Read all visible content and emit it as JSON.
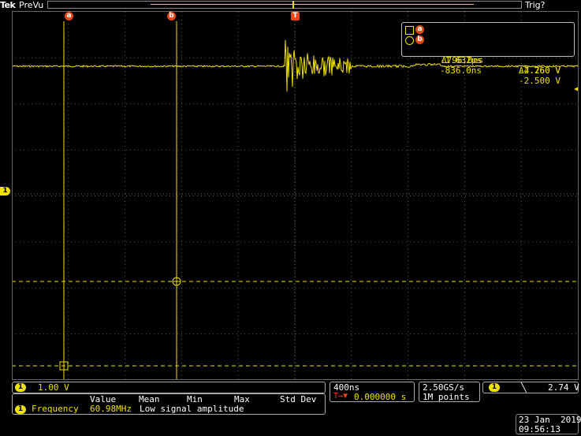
{
  "header": {
    "brand": "Tek",
    "acq_state": "PreVu",
    "trigger_status": "Trig?"
  },
  "cursors": {
    "a_label": "a",
    "b_label": "b",
    "trigger_label": "T",
    "ch1_label": "1",
    "readout": {
      "a_time": "-1.632µs",
      "a_volt": "-4.760 V",
      "b_time": "-836.0ns",
      "b_volt": "-2.500 V",
      "delta_time": "Δ796.0ns",
      "delta_volt": "Δ2.260 V"
    }
  },
  "channel": {
    "label": "1",
    "scale": "1.00 V"
  },
  "measurement": {
    "headers": [
      "Value",
      "Mean",
      "Min",
      "Max",
      "Std Dev"
    ],
    "ch_label": "1",
    "name": "Frequency",
    "value": "60.98MHz",
    "note": "Low signal amplitude"
  },
  "horizontal": {
    "timebase": "400ns",
    "trigger_pos_icon": "T→▼",
    "offset": "0.000000 s"
  },
  "acquisition": {
    "sample_rate": "2.50GS/s",
    "record_length": "1M points"
  },
  "trigger": {
    "ch_label": "1",
    "slope_icon": "╲",
    "level": "2.74 V"
  },
  "datetime": {
    "date": "23 Jan  2019",
    "time": "09:56:13"
  },
  "colors": {
    "trace": "#f0e000",
    "cursor_badge": "#e8471a",
    "grid": "#555555"
  }
}
